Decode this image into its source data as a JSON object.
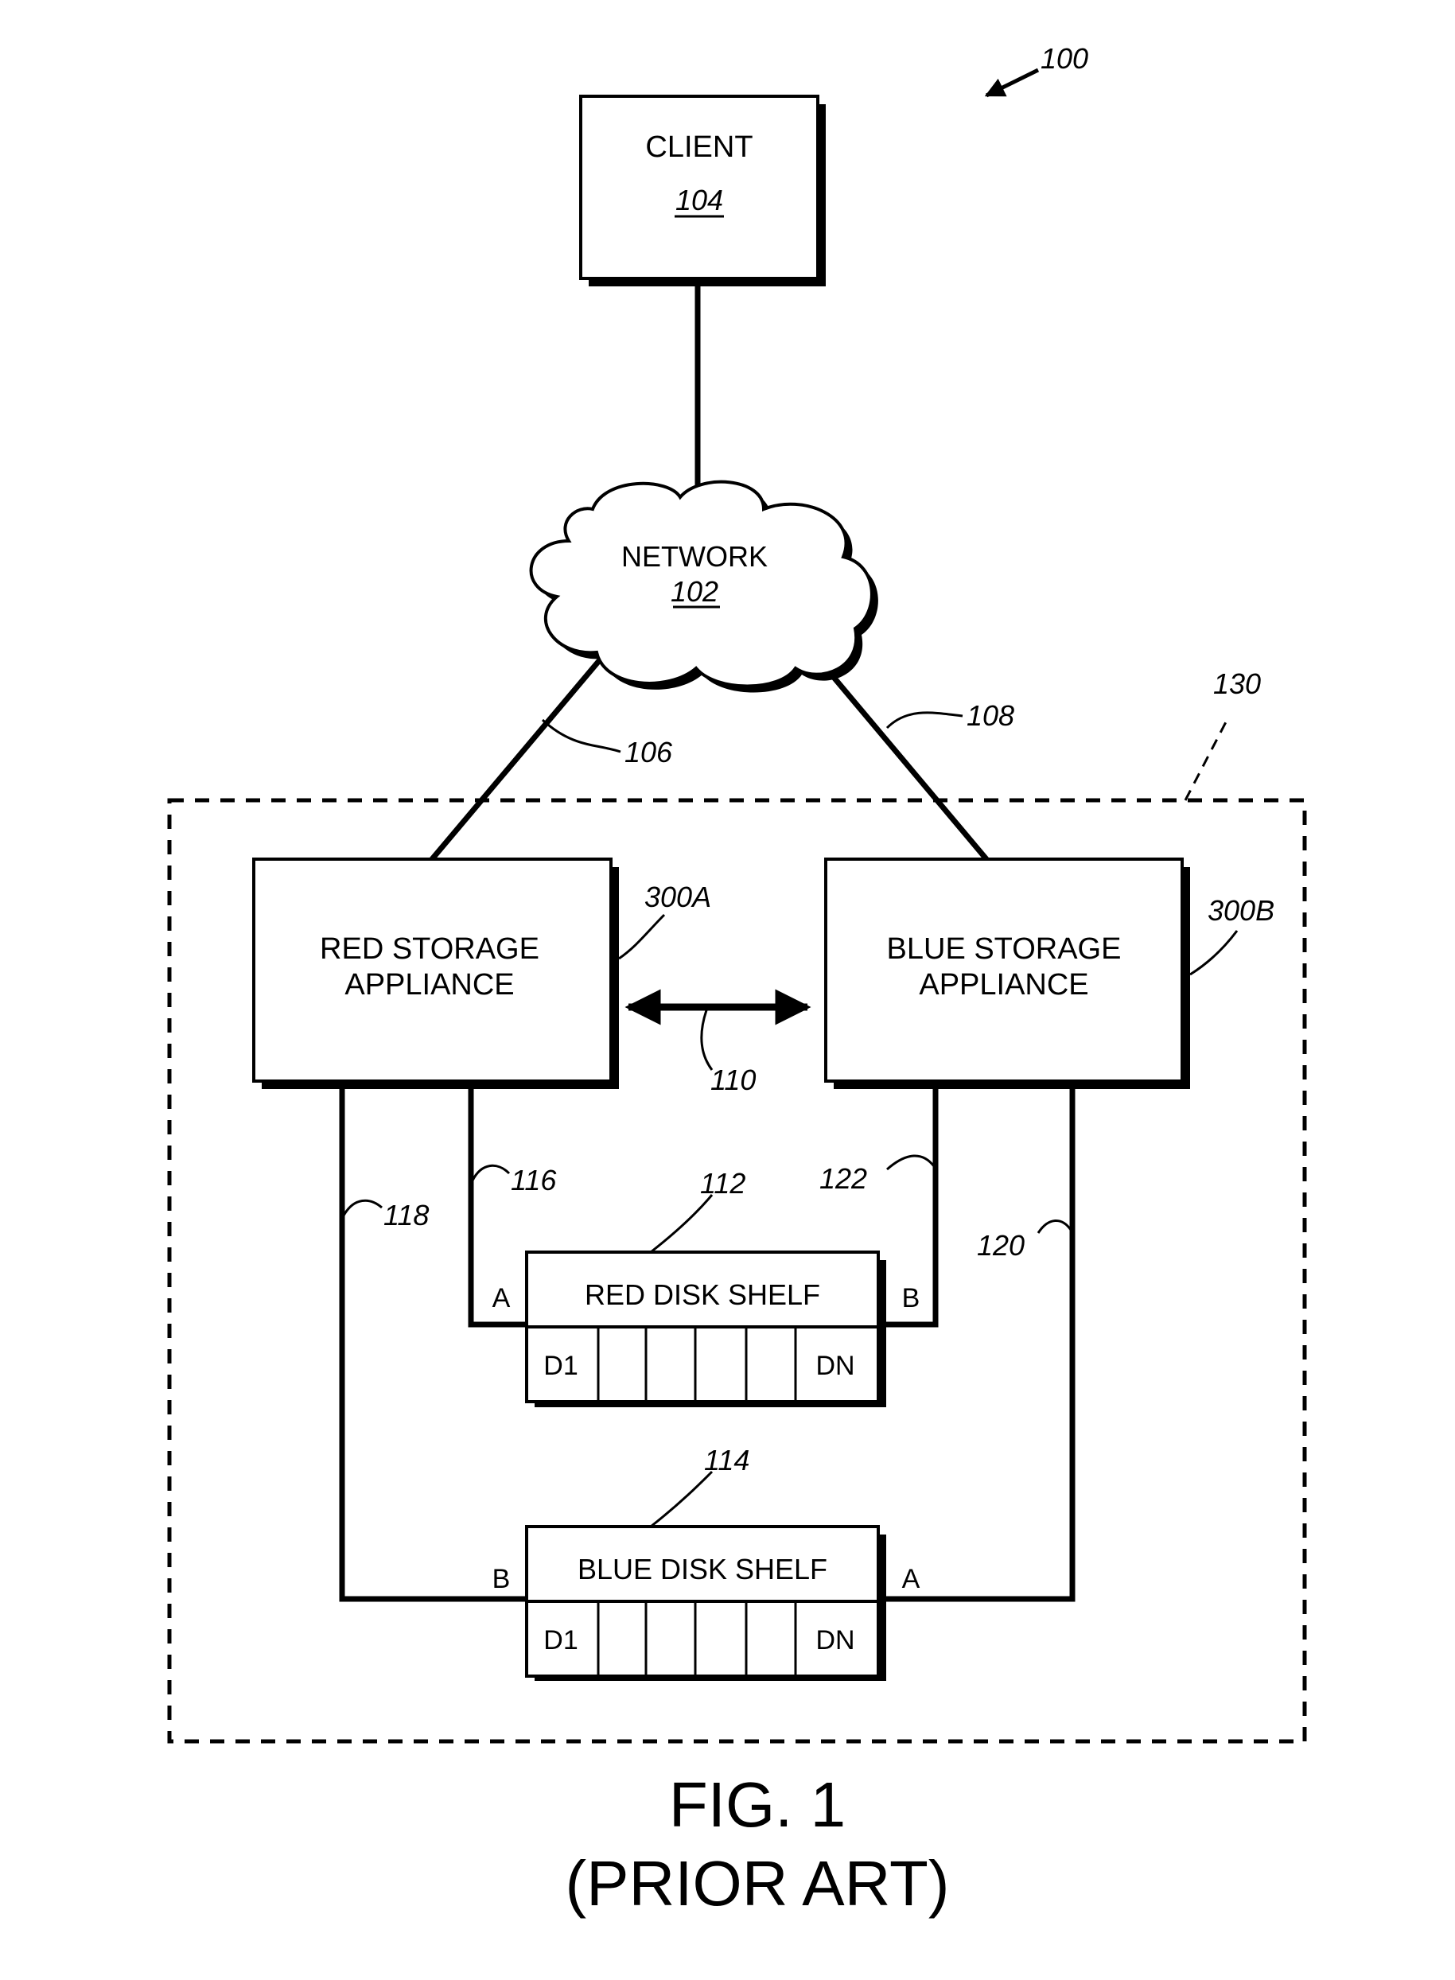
{
  "figure": {
    "ref": "100",
    "caption": "FIG. 1",
    "subcaption": "(PRIOR ART)"
  },
  "nodes": {
    "client": {
      "label": "CLIENT",
      "ref": "104"
    },
    "network": {
      "label": "NETWORK",
      "ref": "102"
    },
    "cluster": {
      "ref": "130"
    },
    "red_appliance": {
      "line1": "RED STORAGE",
      "line2": "APPLIANCE",
      "ref": "300A"
    },
    "blue_appliance": {
      "line1": "BLUE STORAGE",
      "line2": "APPLIANCE",
      "ref": "300B"
    },
    "red_shelf": {
      "label": "RED DISK SHELF",
      "ref": "112",
      "port_left": "A",
      "port_right": "B",
      "disk_first": "D1",
      "disk_last": "DN"
    },
    "blue_shelf": {
      "label": "BLUE DISK SHELF",
      "ref": "114",
      "port_left": "B",
      "port_right": "A",
      "disk_first": "D1",
      "disk_last": "DN"
    }
  },
  "links": {
    "net_red": "106",
    "net_blue": "108",
    "interconnect": "110",
    "red_to_red_shelf": "116",
    "red_to_blue_shelf": "118",
    "blue_to_blue_shelf": "120",
    "blue_to_red_shelf": "122"
  }
}
